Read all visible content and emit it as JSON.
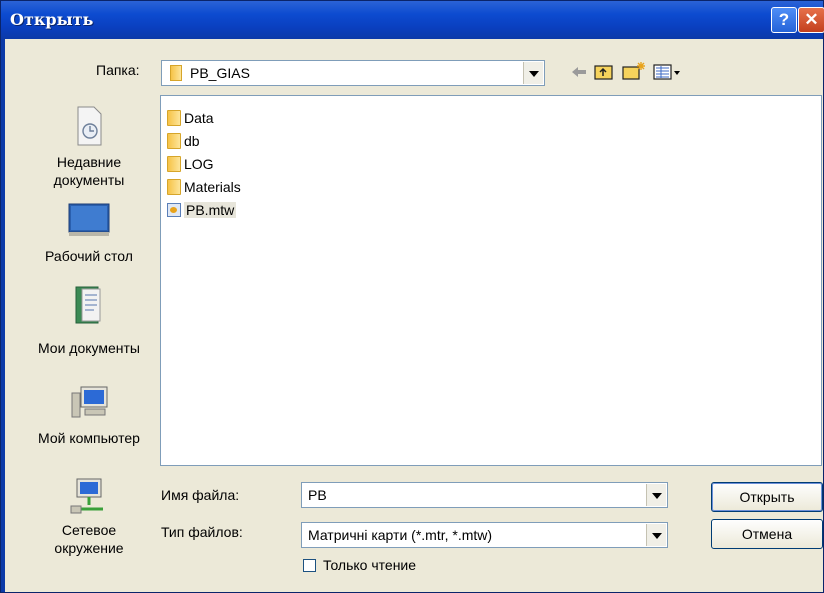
{
  "window": {
    "title": "Открыть",
    "help_glyph": "?",
    "close_glyph": "✕"
  },
  "location": {
    "label": "Папка:",
    "value": "PB_GIAS"
  },
  "toolbar_icons": [
    "back-arrow-icon",
    "up-folder-icon",
    "new-folder-icon",
    "view-menu-icon"
  ],
  "places": [
    {
      "label_lines": [
        "Недавние",
        "документы"
      ],
      "icon": "recent-documents-icon"
    },
    {
      "label_lines": [
        "Рабочий стол"
      ],
      "icon": "desktop-icon"
    },
    {
      "label_lines": [
        "Мои документы"
      ],
      "icon": "my-documents-icon"
    },
    {
      "label_lines": [
        "Мой компьютер"
      ],
      "icon": "my-computer-icon"
    },
    {
      "label_lines": [
        "Сетевое",
        "окружение"
      ],
      "icon": "network-icon"
    }
  ],
  "files": [
    {
      "name": "Data",
      "type": "folder"
    },
    {
      "name": "db",
      "type": "folder"
    },
    {
      "name": "LOG",
      "type": "folder"
    },
    {
      "name": "Materials",
      "type": "folder"
    },
    {
      "name": "PB.mtw",
      "type": "file"
    }
  ],
  "filename": {
    "label": "Имя файла:",
    "value": "PB"
  },
  "filetype": {
    "label": "Тип файлов:",
    "value": "Матричні карти (*.mtr, *.mtw)"
  },
  "readonly": {
    "label": "Только чтение",
    "checked": false
  },
  "buttons": {
    "open": "Открыть",
    "cancel": "Отмена"
  },
  "colors": {
    "titlebar": "#0c4bd0",
    "dialog_bg": "#ece9d8",
    "field_border": "#7f9db9"
  }
}
